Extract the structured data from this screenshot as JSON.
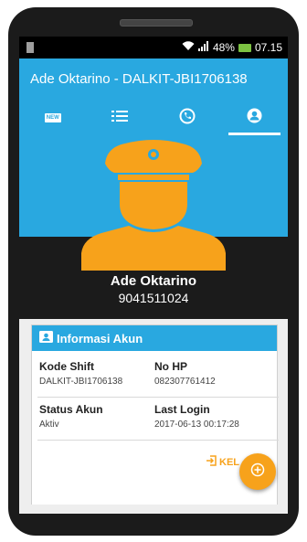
{
  "statusbar": {
    "battery": "48%",
    "time": "07.15"
  },
  "appbar": {
    "title": "Ade Oktarino - DALKIT-JBI1706138"
  },
  "tabs": [
    {
      "icon": "new-badge-icon",
      "label": "NEW"
    },
    {
      "icon": "list-icon"
    },
    {
      "icon": "phone-icon"
    },
    {
      "icon": "account-icon",
      "active": true
    }
  ],
  "profile": {
    "name": "Ade Oktarino",
    "number": "9041511024"
  },
  "card": {
    "title": "Informasi Akun",
    "fields": {
      "kode_shift": {
        "label": "Kode Shift",
        "value": "DALKIT-JBI1706138"
      },
      "no_hp": {
        "label": "No HP",
        "value": "082307761412"
      },
      "status_akun": {
        "label": "Status Akun",
        "value": "Aktiv"
      },
      "last_login": {
        "label": "Last Login",
        "value": "2017-06-13 00:17:28"
      }
    },
    "logout_label": "KEL"
  },
  "colors": {
    "primary": "#29a8e0",
    "accent": "#f7a21b"
  }
}
